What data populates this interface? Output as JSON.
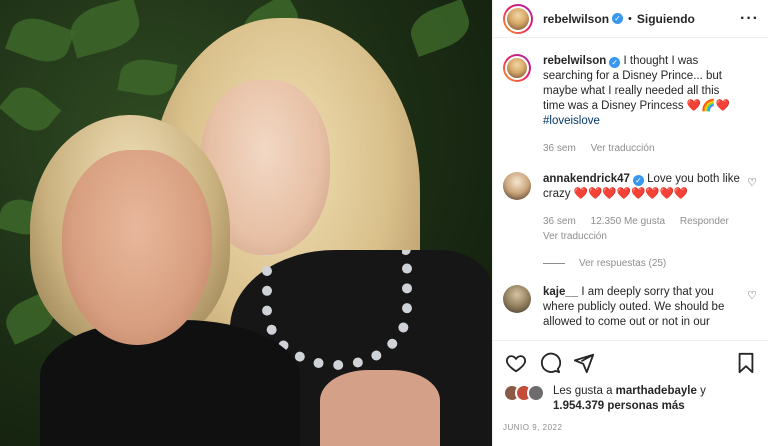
{
  "post": {
    "username": "rebelwilson",
    "separator": "•",
    "follow_label": "Siguiendo",
    "more_icon": "more-options-icon"
  },
  "caption": {
    "username": "rebelwilson",
    "text": "I thought I was searching for a Disney Prince... but maybe what I really needed all this time was a Disney Princess",
    "emojis": "❤️🌈❤️",
    "hashtag": "#loveislove",
    "time": "36 sem",
    "translate": "Ver traducción"
  },
  "comments": [
    {
      "username": "annakendrick47",
      "text": "Love you both like crazy",
      "emojis": "❤️❤️❤️❤️❤️❤️❤️❤️",
      "time": "36 sem",
      "likes": "12.350 Me gusta",
      "reply": "Responder",
      "translate": "Ver traducción",
      "view_replies": "Ver respuestas (25)"
    },
    {
      "username": "kaje__",
      "text": "I am deeply sorry that you where publicly outed. We should be allowed to come out or not in our"
    }
  ],
  "likes": {
    "prefix": "Les gusta a",
    "user": "marthadebayle",
    "connector": "y",
    "count": "1.954.379 personas más"
  },
  "date": "JUNIO 9, 2022",
  "colors": {
    "verified": "#3897f0",
    "link": "#00376b",
    "heart": "#ed4956",
    "secondary": "#8e8e8e"
  }
}
